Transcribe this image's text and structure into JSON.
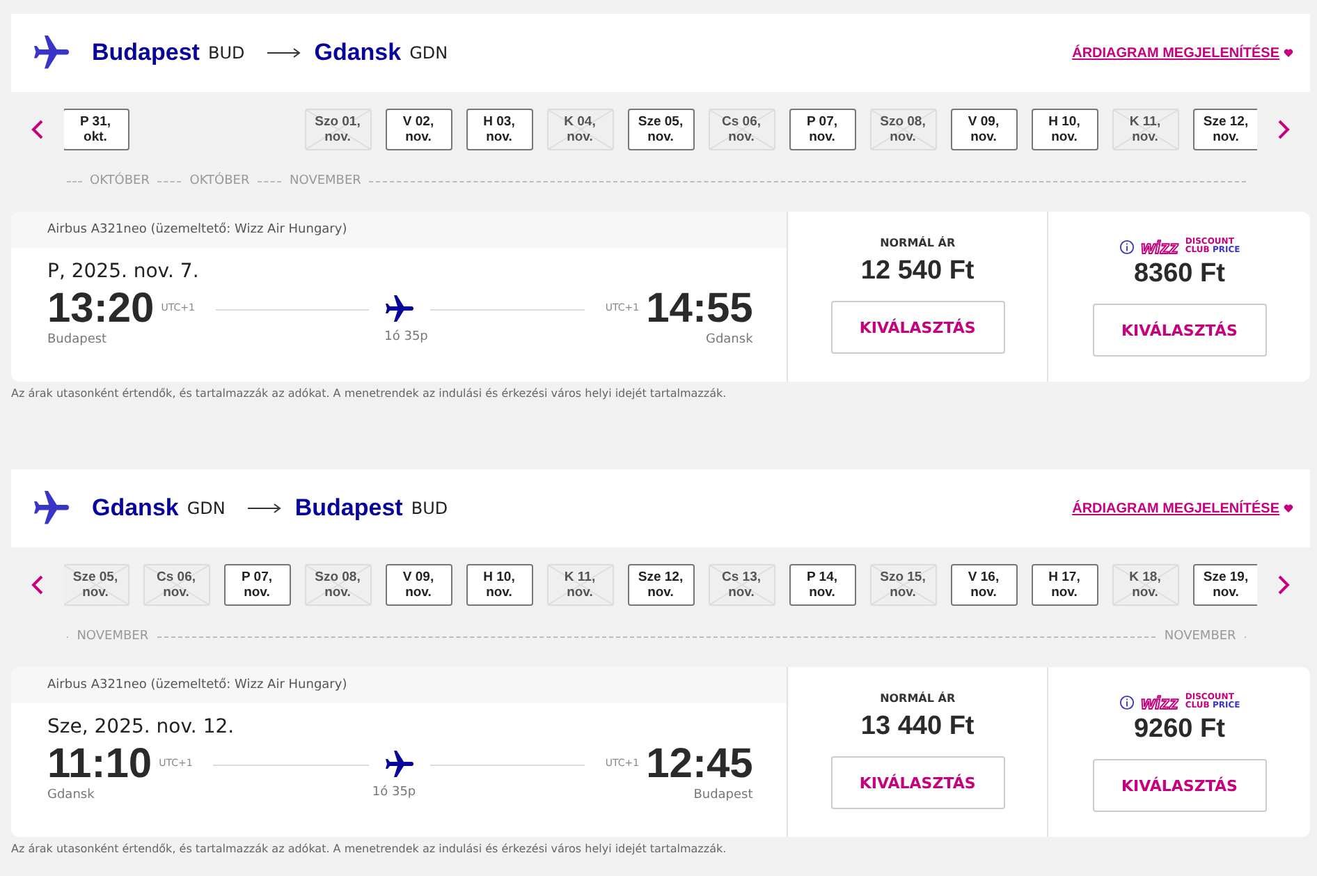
{
  "flights": [
    {
      "from": {
        "city": "Budapest",
        "code": "BUD"
      },
      "to": {
        "city": "Gdansk",
        "code": "GDN"
      },
      "chart_link": "ÁRDIAGRAM MEGJELENÍTÉSE",
      "dates": [
        {
          "kind": "date",
          "day": "P 31,",
          "month": "okt.",
          "disabled": false
        },
        {
          "kind": "empty"
        },
        {
          "kind": "empty"
        },
        {
          "kind": "date",
          "day": "Szo 01,",
          "month": "nov.",
          "disabled": true
        },
        {
          "kind": "date",
          "day": "V 02,",
          "month": "nov.",
          "disabled": false
        },
        {
          "kind": "date",
          "day": "H 03,",
          "month": "nov.",
          "disabled": false
        },
        {
          "kind": "date",
          "day": "K 04,",
          "month": "nov.",
          "disabled": true
        },
        {
          "kind": "date",
          "day": "Sze 05,",
          "month": "nov.",
          "disabled": false
        },
        {
          "kind": "date",
          "day": "Cs 06,",
          "month": "nov.",
          "disabled": true
        },
        {
          "kind": "date",
          "day": "P 07,",
          "month": "nov.",
          "disabled": false
        },
        {
          "kind": "date",
          "day": "Szo 08,",
          "month": "nov.",
          "disabled": true
        },
        {
          "kind": "date",
          "day": "V 09,",
          "month": "nov.",
          "disabled": false
        },
        {
          "kind": "date",
          "day": "H 10,",
          "month": "nov.",
          "disabled": false
        },
        {
          "kind": "date",
          "day": "K 11,",
          "month": "nov.",
          "disabled": true
        },
        {
          "kind": "date",
          "day": "Sze 12,",
          "month": "nov.",
          "disabled": false
        }
      ],
      "months": [
        "OKTÓBER",
        "OKTÓBER",
        "NOVEMBER"
      ],
      "aircraft": "Airbus A321neo (üzemeltető: Wizz Air Hungary)",
      "date": "P, 2025. nov. 7.",
      "departure": {
        "time": "13:20",
        "tz": "UTC+1",
        "city": "Budapest"
      },
      "arrival": {
        "time": "14:55",
        "tz": "UTC+1",
        "city": "Gdansk"
      },
      "duration": "1ó 35p",
      "normal": {
        "label": "NORMÁL ÁR",
        "price": "12 540 Ft",
        "button": "KIVÁLASZTÁS"
      },
      "club": {
        "brand": "wizz",
        "line1": "DISCOUNT",
        "line2a": "CLUB",
        "line2b": "PRICE",
        "price": "8360 Ft",
        "button": "KIVÁLASZTÁS"
      },
      "note": "Az árak utasonként értendők, és tartalmazzák az adókat. A menetrendek az indulási és érkezési város helyi idejét tartalmazzák."
    },
    {
      "from": {
        "city": "Gdansk",
        "code": "GDN"
      },
      "to": {
        "city": "Budapest",
        "code": "BUD"
      },
      "chart_link": "ÁRDIAGRAM MEGJELENÍTÉSE",
      "dates": [
        {
          "kind": "date",
          "day": "Sze 05,",
          "month": "nov.",
          "disabled": true
        },
        {
          "kind": "date",
          "day": "Cs 06,",
          "month": "nov.",
          "disabled": true
        },
        {
          "kind": "date",
          "day": "P 07,",
          "month": "nov.",
          "disabled": false
        },
        {
          "kind": "date",
          "day": "Szo 08,",
          "month": "nov.",
          "disabled": true
        },
        {
          "kind": "date",
          "day": "V 09,",
          "month": "nov.",
          "disabled": false
        },
        {
          "kind": "date",
          "day": "H 10,",
          "month": "nov.",
          "disabled": false
        },
        {
          "kind": "date",
          "day": "K 11,",
          "month": "nov.",
          "disabled": true
        },
        {
          "kind": "date",
          "day": "Sze 12,",
          "month": "nov.",
          "disabled": false
        },
        {
          "kind": "date",
          "day": "Cs 13,",
          "month": "nov.",
          "disabled": true
        },
        {
          "kind": "date",
          "day": "P 14,",
          "month": "nov.",
          "disabled": false
        },
        {
          "kind": "date",
          "day": "Szo 15,",
          "month": "nov.",
          "disabled": true
        },
        {
          "kind": "date",
          "day": "V 16,",
          "month": "nov.",
          "disabled": false
        },
        {
          "kind": "date",
          "day": "H 17,",
          "month": "nov.",
          "disabled": false
        },
        {
          "kind": "date",
          "day": "K 18,",
          "month": "nov.",
          "disabled": true
        },
        {
          "kind": "date",
          "day": "Sze 19,",
          "month": "nov.",
          "disabled": false
        }
      ],
      "months": [
        "NOVEMBER",
        "NOVEMBER"
      ],
      "aircraft": "Airbus A321neo (üzemeltető: Wizz Air Hungary)",
      "date": "Sze, 2025. nov. 12.",
      "departure": {
        "time": "11:10",
        "tz": "UTC+1",
        "city": "Gdansk"
      },
      "arrival": {
        "time": "12:45",
        "tz": "UTC+1",
        "city": "Budapest"
      },
      "duration": "1ó 35p",
      "normal": {
        "label": "NORMÁL ÁR",
        "price": "13 440 Ft",
        "button": "KIVÁLASZTÁS"
      },
      "club": {
        "brand": "wizz",
        "line1": "DISCOUNT",
        "line2a": "CLUB",
        "line2b": "PRICE",
        "price": "9260 Ft",
        "button": "KIVÁLASZTÁS"
      },
      "note": "Az árak utasonként értendők, és tartalmazzák az adókat. A menetrendek az indulási és érkezési város helyi idejét tartalmazzák."
    }
  ]
}
